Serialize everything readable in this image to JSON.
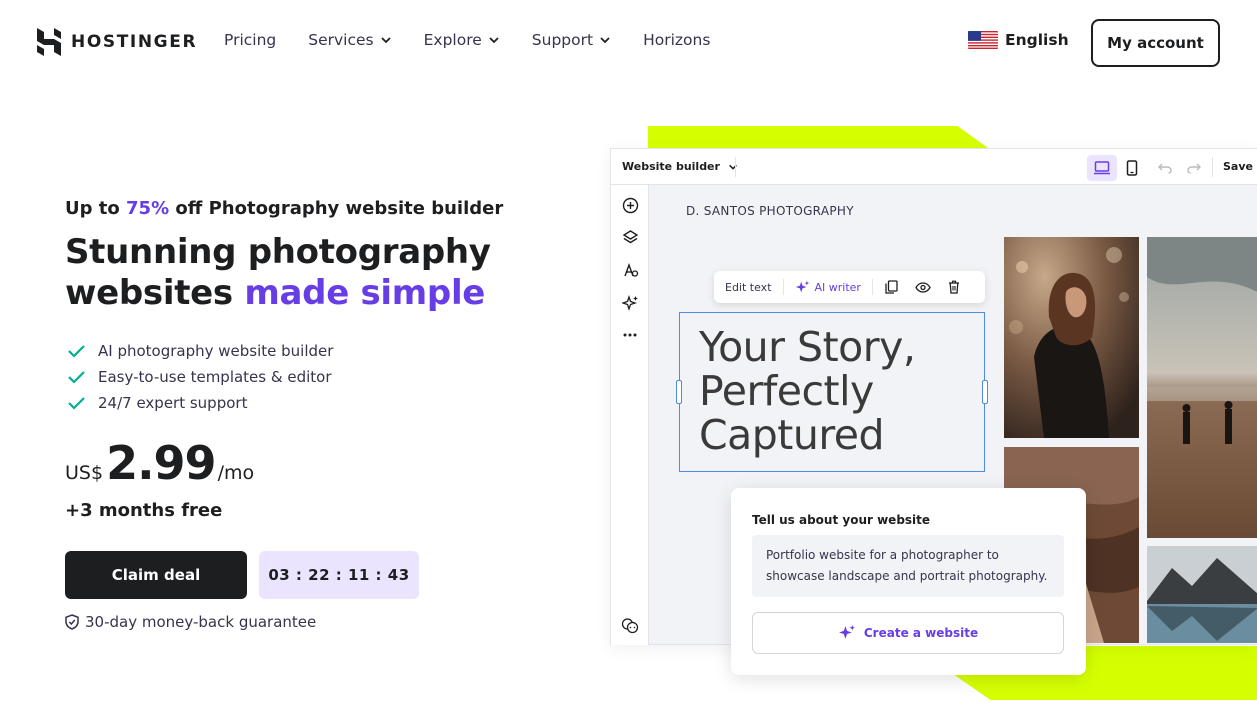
{
  "header": {
    "logo_text": "HOSTINGER",
    "nav": [
      {
        "label": "Pricing",
        "dropdown": false
      },
      {
        "label": "Services",
        "dropdown": true
      },
      {
        "label": "Explore",
        "dropdown": true
      },
      {
        "label": "Support",
        "dropdown": true
      },
      {
        "label": "Horizons",
        "dropdown": false
      }
    ],
    "language": "English",
    "account_label": "My account"
  },
  "hero": {
    "promo_prefix": "Up to ",
    "promo_pct": "75%",
    "promo_suffix": " off Photography website builder",
    "headline_line1": "Stunning photography",
    "headline_line2_plain": "websites ",
    "headline_line2_accent": "made simple",
    "features": [
      "AI photography website builder",
      "Easy-to-use templates & editor",
      "24/7 expert support"
    ],
    "currency": "US$",
    "price": "2.99",
    "period": "/mo",
    "bonus": "+3 months free",
    "cta_label": "Claim deal",
    "countdown": "03 : 22 : 11 : 43",
    "guarantee": "30-day money-back guarantee"
  },
  "builder": {
    "selector_label": "Website builder",
    "save_label": "Save",
    "brand_name": "D. SANTOS PHOTOGRAPHY",
    "edit_text_label": "Edit text",
    "ai_writer_label": "AI writer",
    "story_line1": "Your Story,",
    "story_line2": "Perfectly",
    "story_line3": "Captured",
    "prompt_label": "Tell us about your website",
    "prompt_text": "Portfolio website for a photographer to showcase landscape and portrait photography.",
    "create_label": "Create a website"
  },
  "colors": {
    "accent": "#673de6",
    "lime": "#d5ff00",
    "dark": "#1d1e20",
    "check": "#00b090",
    "timer_bg": "#ebe4ff"
  }
}
